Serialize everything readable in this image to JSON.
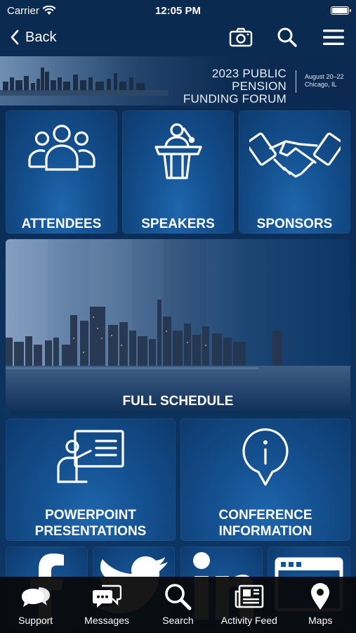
{
  "status_bar": {
    "carrier": "Carrier",
    "time": "12:05 PM"
  },
  "nav": {
    "back_label": "Back"
  },
  "banner": {
    "title_line1": "2023 PUBLIC PENSION",
    "title_line2": "FUNDING FORUM",
    "date_line1": "August 20–22",
    "date_line2": "Chicago, IL"
  },
  "tiles": {
    "attendees": "ATTENDEES",
    "speakers": "SPEAKERS",
    "sponsors": "SPONSORS",
    "schedule": "FULL SCHEDULE",
    "powerpoint_line1": "POWERPOINT",
    "powerpoint_line2": "PRESENTATIONS",
    "conference_line1": "CONFERENCE",
    "conference_line2": "INFORMATION"
  },
  "social_tiles": [
    "facebook-icon",
    "twitter-icon",
    "linkedin-icon",
    "browser-icon"
  ],
  "tab_bar": [
    {
      "label": "Support",
      "icon": "chat-bubbles-icon"
    },
    {
      "label": "Messages",
      "icon": "message-icon"
    },
    {
      "label": "Search",
      "icon": "search-icon"
    },
    {
      "label": "Activity Feed",
      "icon": "newspaper-icon"
    },
    {
      "label": "Maps",
      "icon": "map-pin-icon"
    }
  ],
  "colors": {
    "background": "#0b2f57",
    "tile": "#155292",
    "tab_bar": "#0a0a0c"
  }
}
